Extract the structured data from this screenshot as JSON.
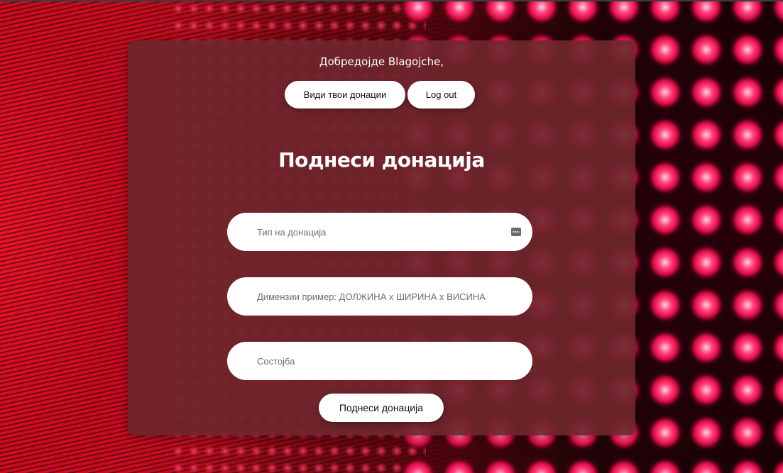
{
  "greeting": "Добредојде Blagojche,",
  "nav": {
    "view_donations_label": "Види твои донации",
    "logout_label": "Log out"
  },
  "form": {
    "title": "Поднеси донација",
    "type_placeholder": "Тип на донација",
    "type_icon": "keyboard-icon",
    "dimensions_placeholder": "Димензии пример: ДОЛЖИНА x ШИРИНА x ВИСИНА",
    "state_placeholder": "Состојба",
    "submit_label": "Поднеси донација"
  },
  "colors": {
    "panel": "#6e262c",
    "button": "#ffffff",
    "accent_background": "#e0162a"
  }
}
